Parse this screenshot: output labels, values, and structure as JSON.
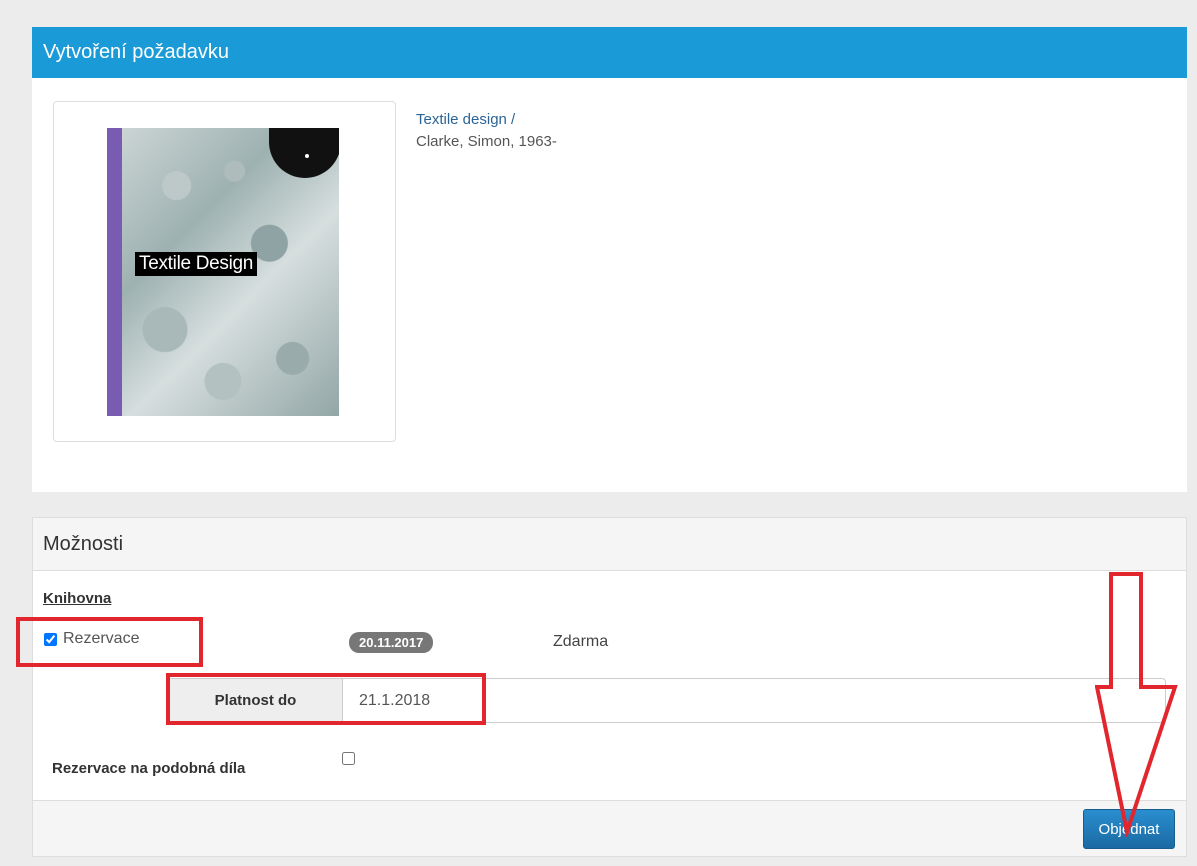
{
  "request_panel": {
    "title": "Vytvoření požadavku",
    "book": {
      "cover_title": "Textile Design",
      "title_link": "Textile design /",
      "author": "Clarke, Simon, 1963-"
    }
  },
  "options_panel": {
    "title": "Možnosti",
    "library_label": "Knihovna",
    "reservation": {
      "label": "Rezervace",
      "checked": true,
      "date_badge": "20.11.2017",
      "price": "Zdarma"
    },
    "valid_until": {
      "label": "Platnost do",
      "value": "21.1.2018"
    },
    "similar_works": {
      "label": "Rezervace na podobná díla",
      "checked": false
    },
    "order_button_label": "Objednat"
  },
  "colors": {
    "header_blue": "#1b9ad8",
    "annotation_red": "#e2262d",
    "button_blue": "#1a6aa3"
  }
}
